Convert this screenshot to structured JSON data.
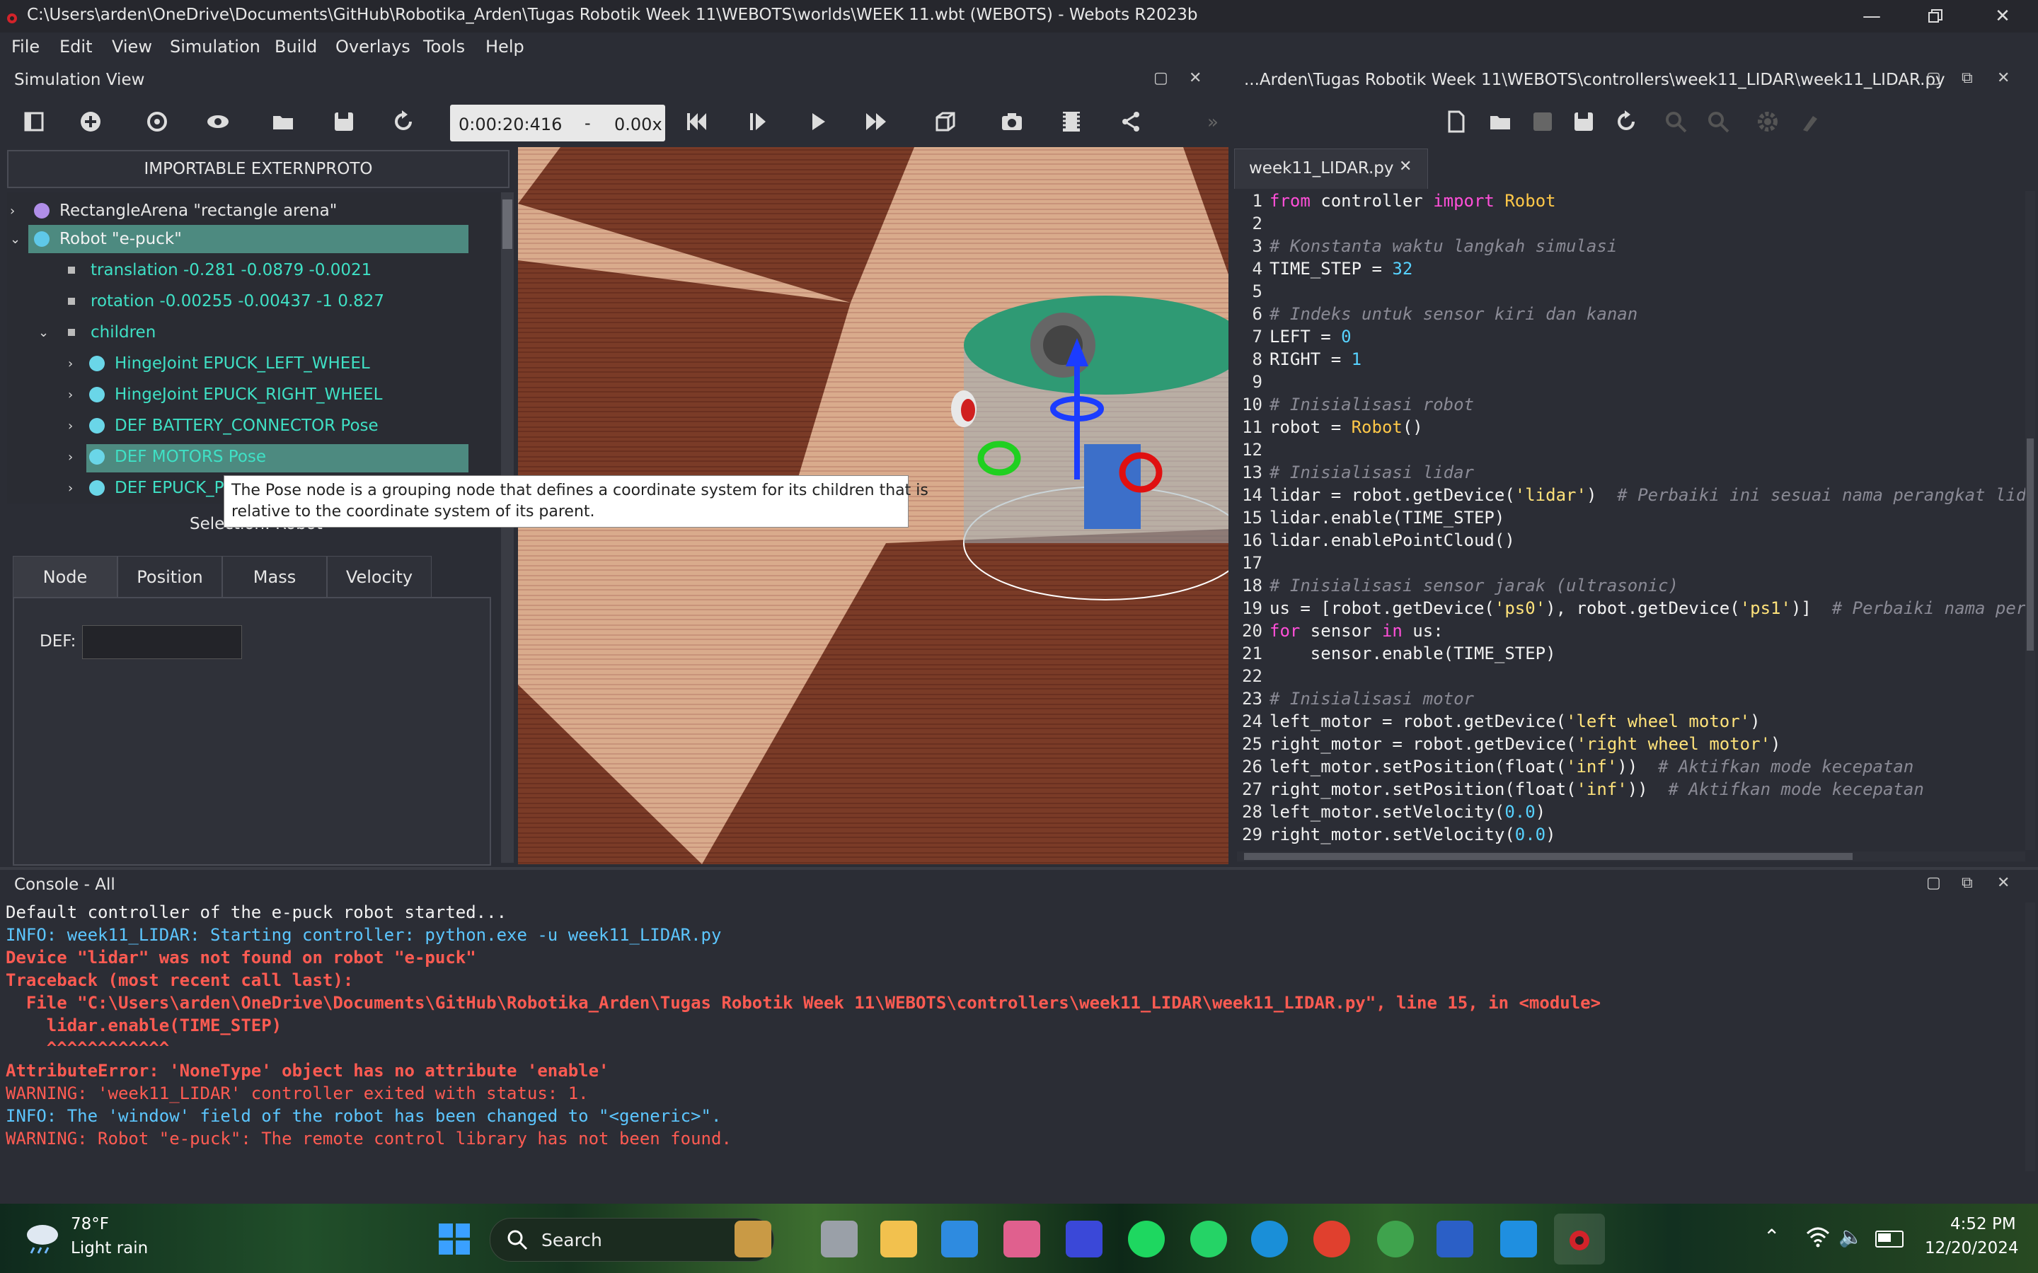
{
  "window": {
    "title": "C:\\Users\\arden\\OneDrive\\Documents\\GitHub\\Robotika_Arden\\Tugas Robotik Week 11\\WEBOTS\\worlds\\WEEK 11.wbt (WEBOTS) - Webots R2023b"
  },
  "menu": [
    "File",
    "Edit",
    "View",
    "Simulation",
    "Build",
    "Overlays",
    "Tools",
    "Help"
  ],
  "simulation_view": {
    "title": "Simulation View",
    "time": "0:00:20:416",
    "separator": "-",
    "speed": "0.00x"
  },
  "scene_tree": {
    "proto_button": "IMPORTABLE EXTERNPROTO",
    "rows": [
      {
        "label": "RectangleArena \"rectangle arena\""
      },
      {
        "label": "Robot \"e-puck\""
      },
      {
        "label": "translation -0.281 -0.0879 -0.0021"
      },
      {
        "label": "rotation -0.00255 -0.00437 -1 0.827"
      },
      {
        "label": "children"
      },
      {
        "label": "HingeJoint EPUCK_LEFT_WHEEL"
      },
      {
        "label": "HingeJoint EPUCK_RIGHT_WHEEL"
      },
      {
        "label": "DEF BATTERY_CONNECTOR Pose"
      },
      {
        "label": "DEF MOTORS Pose"
      },
      {
        "label": "DEF EPUCK_PL"
      }
    ],
    "tooltip_line1": "The Pose node is a grouping node that defines a coordinate system for its children that is",
    "tooltip_line2": "relative to the coordinate system of its parent.",
    "selection_label": "Selection: Robot"
  },
  "field_editor": {
    "tabs": [
      "Node",
      "Position",
      "Mass",
      "Velocity"
    ],
    "def_label": "DEF:",
    "def_value": ""
  },
  "editor": {
    "path": "...Arden\\Tugas Robotik Week 11\\WEBOTS\\controllers\\week11_LIDAR\\week11_LIDAR.py",
    "tab_name": "week11_LIDAR.py",
    "lines": [
      {
        "n": "1",
        "parts": [
          [
            "kw",
            "from"
          ],
          [
            "pl",
            " controller "
          ],
          [
            "kw",
            "import"
          ],
          [
            "pl",
            " "
          ],
          [
            "cls",
            "Robot"
          ]
        ]
      },
      {
        "n": "2",
        "parts": []
      },
      {
        "n": "3",
        "parts": [
          [
            "cmt",
            "# Konstanta waktu langkah simulasi"
          ]
        ]
      },
      {
        "n": "4",
        "parts": [
          [
            "pl",
            "TIME_STEP = "
          ],
          [
            "num",
            "32"
          ]
        ]
      },
      {
        "n": "5",
        "parts": []
      },
      {
        "n": "6",
        "parts": [
          [
            "cmt",
            "# Indeks untuk sensor kiri dan kanan"
          ]
        ]
      },
      {
        "n": "7",
        "parts": [
          [
            "pl",
            "LEFT = "
          ],
          [
            "num",
            "0"
          ]
        ]
      },
      {
        "n": "8",
        "parts": [
          [
            "pl",
            "RIGHT = "
          ],
          [
            "num",
            "1"
          ]
        ]
      },
      {
        "n": "9",
        "parts": []
      },
      {
        "n": "10",
        "parts": [
          [
            "cmt",
            "# Inisialisasi robot"
          ]
        ]
      },
      {
        "n": "11",
        "parts": [
          [
            "pl",
            "robot = "
          ],
          [
            "cls",
            "Robot"
          ],
          [
            "pl",
            "()"
          ]
        ]
      },
      {
        "n": "12",
        "parts": []
      },
      {
        "n": "13",
        "parts": [
          [
            "cmt",
            "# Inisialisasi lidar"
          ]
        ]
      },
      {
        "n": "14",
        "parts": [
          [
            "pl",
            "lidar = robot.getDevice("
          ],
          [
            "str",
            "'lidar'"
          ],
          [
            "pl",
            ")  "
          ],
          [
            "cmt",
            "# Perbaiki ini sesuai nama perangkat lida"
          ]
        ]
      },
      {
        "n": "15",
        "parts": [
          [
            "pl",
            "lidar.enable(TIME_STEP)"
          ]
        ]
      },
      {
        "n": "16",
        "parts": [
          [
            "pl",
            "lidar.enablePointCloud()"
          ]
        ]
      },
      {
        "n": "17",
        "parts": []
      },
      {
        "n": "18",
        "parts": [
          [
            "cmt",
            "# Inisialisasi sensor jarak (ultrasonic)"
          ]
        ]
      },
      {
        "n": "19",
        "parts": [
          [
            "pl",
            "us = [robot.getDevice("
          ],
          [
            "str",
            "'ps0'"
          ],
          [
            "pl",
            "), robot.getDevice("
          ],
          [
            "str",
            "'ps1'"
          ],
          [
            "pl",
            ")]  "
          ],
          [
            "cmt",
            "# Perbaiki nama pera"
          ]
        ]
      },
      {
        "n": "20",
        "parts": [
          [
            "kw",
            "for"
          ],
          [
            "pl",
            " sensor "
          ],
          [
            "kw",
            "in"
          ],
          [
            "pl",
            " us:"
          ]
        ]
      },
      {
        "n": "21",
        "parts": [
          [
            "pl",
            "    sensor.enable(TIME_STEP)"
          ]
        ]
      },
      {
        "n": "22",
        "parts": []
      },
      {
        "n": "23",
        "parts": [
          [
            "cmt",
            "# Inisialisasi motor"
          ]
        ]
      },
      {
        "n": "24",
        "parts": [
          [
            "pl",
            "left_motor = robot.getDevice("
          ],
          [
            "str",
            "'left wheel motor'"
          ],
          [
            "pl",
            ")"
          ]
        ]
      },
      {
        "n": "25",
        "parts": [
          [
            "pl",
            "right_motor = robot.getDevice("
          ],
          [
            "str",
            "'right wheel motor'"
          ],
          [
            "pl",
            ")"
          ]
        ]
      },
      {
        "n": "26",
        "parts": [
          [
            "pl",
            "left_motor.setPosition(float("
          ],
          [
            "str",
            "'inf'"
          ],
          [
            "pl",
            "))  "
          ],
          [
            "cmt",
            "# Aktifkan mode kecepatan"
          ]
        ]
      },
      {
        "n": "27",
        "parts": [
          [
            "pl",
            "right_motor.setPosition(float("
          ],
          [
            "str",
            "'inf'"
          ],
          [
            "pl",
            "))  "
          ],
          [
            "cmt",
            "# Aktifkan mode kecepatan"
          ]
        ]
      },
      {
        "n": "28",
        "parts": [
          [
            "pl",
            "left_motor.setVelocity("
          ],
          [
            "num",
            "0.0"
          ],
          [
            "pl",
            ")"
          ]
        ]
      },
      {
        "n": "29",
        "parts": [
          [
            "pl",
            "right_motor.setVelocity("
          ],
          [
            "num",
            "0.0"
          ],
          [
            "pl",
            ")"
          ]
        ]
      }
    ]
  },
  "console": {
    "title": "Console - All",
    "lines": [
      {
        "text": "Default controller of the e-puck robot started...",
        "color": "#f2f2f2",
        "bold": false
      },
      {
        "text": "INFO: week11_LIDAR: Starting controller: python.exe -u week11_LIDAR.py",
        "color": "#5cc6ff",
        "bold": false
      },
      {
        "text": "Device \"lidar\" was not found on robot \"e-puck\"",
        "color": "#ff5b52",
        "bold": true
      },
      {
        "text": "Traceback (most recent call last):",
        "color": "#ff5b52",
        "bold": true
      },
      {
        "text": "  File \"C:\\Users\\arden\\OneDrive\\Documents\\GitHub\\Robotika_Arden\\Tugas Robotik Week 11\\WEBOTS\\controllers\\week11_LIDAR\\week11_LIDAR.py\", line 15, in <module>",
        "color": "#ff5b52",
        "bold": true
      },
      {
        "text": "    lidar.enable(TIME_STEP)",
        "color": "#ff5b52",
        "bold": true
      },
      {
        "text": "    ^^^^^^^^^^^^",
        "color": "#ff5b52",
        "bold": true
      },
      {
        "text": "AttributeError: 'NoneType' object has no attribute 'enable'",
        "color": "#ff5b52",
        "bold": true
      },
      {
        "text": "WARNING: 'week11_LIDAR' controller exited with status: 1.",
        "color": "#ff5b52",
        "bold": false
      },
      {
        "text": "INFO: The 'window' field of the robot has been changed to \"<generic>\".",
        "color": "#5cc6ff",
        "bold": false
      },
      {
        "text": "WARNING: Robot \"e-puck\": The remote control library has not been found.",
        "color": "#ff5b52",
        "bold": false
      }
    ]
  },
  "taskbar": {
    "weather_temp": "78°F",
    "weather_desc": "Light rain",
    "search_label": "Search",
    "time": "4:52 PM",
    "date": "12/20/2024"
  },
  "colors": {
    "accent_teal": "#3fe0c5",
    "selected_row": "#4d8a80",
    "error_red": "#ff5b52",
    "info_blue": "#5cc6ff"
  }
}
